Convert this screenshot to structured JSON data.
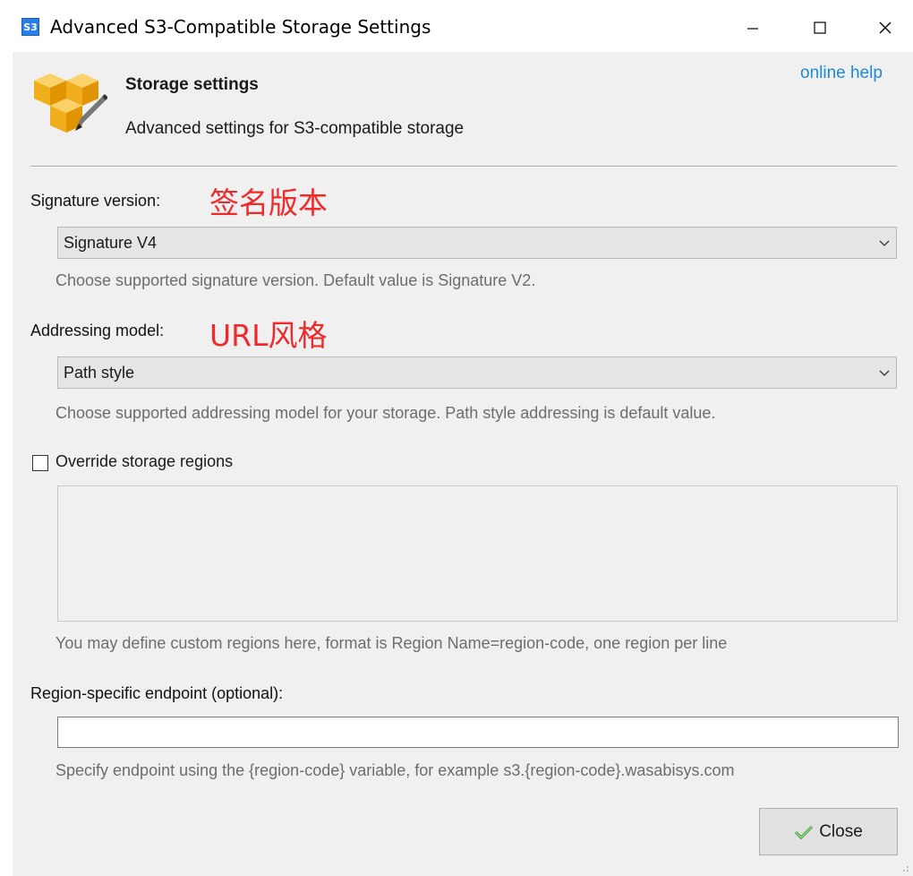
{
  "window": {
    "title": "Advanced S3-Compatible Storage Settings",
    "app_icon_text": "S3",
    "controls": {
      "minimize": "minimize-icon",
      "maximize": "maximize-icon",
      "close": "close-icon"
    }
  },
  "header": {
    "title": "Storage settings",
    "subtitle": "Advanced settings for S3-compatible storage",
    "help_link": "online help",
    "icon": "storage-boxes-pencil-icon"
  },
  "signature": {
    "label": "Signature version:",
    "annotation": "签名版本",
    "selected": "Signature V4",
    "hint": "Choose supported signature version. Default value is Signature V2."
  },
  "addressing": {
    "label": "Addressing model:",
    "annotation": "URL风格",
    "selected": "Path style",
    "hint": "Choose supported addressing model for your storage. Path style addressing is default value."
  },
  "regions": {
    "checkbox_label": "Override storage regions",
    "checked": false,
    "hint": "You may define custom regions here, format is Region Name=region-code, one region per line"
  },
  "endpoint": {
    "label": "Region-specific endpoint (optional):",
    "value": "",
    "hint": "Specify endpoint using the {region-code} variable, for example s3.{region-code}.wasabisys.com"
  },
  "footer": {
    "close_label": "Close"
  },
  "colors": {
    "annotation": "#f02a2a",
    "link": "#1c8ad8",
    "client_bg": "#f0f0f0",
    "check_green": "#2e9a2e"
  }
}
